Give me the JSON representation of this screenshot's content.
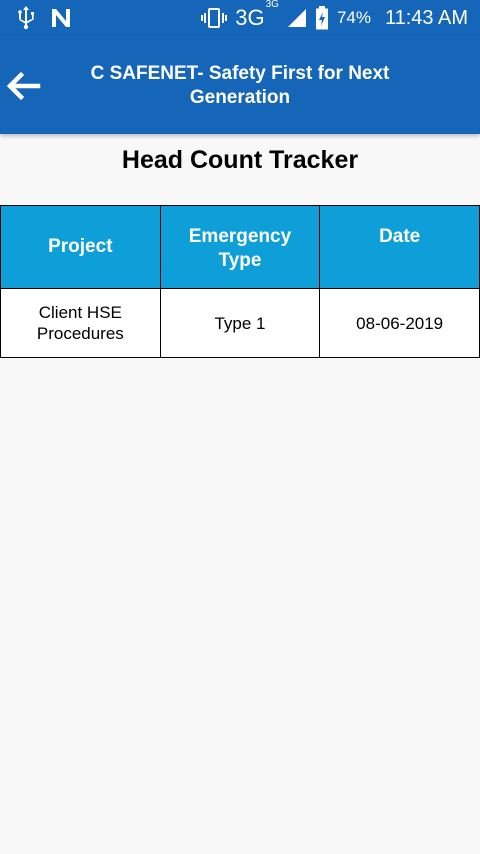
{
  "status_bar": {
    "left_icons": [
      "usb-icon",
      "n-icon"
    ],
    "network": "3G",
    "network_sup": "3G",
    "battery": "74%",
    "time": "11:43 AM"
  },
  "app_bar": {
    "title_line1": "C SAFENET- Safety First for Next",
    "title_line2": "Generation",
    "back_icon": "arrow-left-icon",
    "color": "#1565b8"
  },
  "page": {
    "heading": "Head Count Tracker"
  },
  "table": {
    "header_color": "#0f9fd8",
    "headers": {
      "project": "Project",
      "emergency_line1": "Emergency",
      "emergency_line2": "Type",
      "date": "Date"
    },
    "rows": [
      {
        "project_line1": "Client HSE",
        "project_line2": "Procedures",
        "emergency_type": "Type 1",
        "date": "08-06-2019"
      }
    ]
  }
}
